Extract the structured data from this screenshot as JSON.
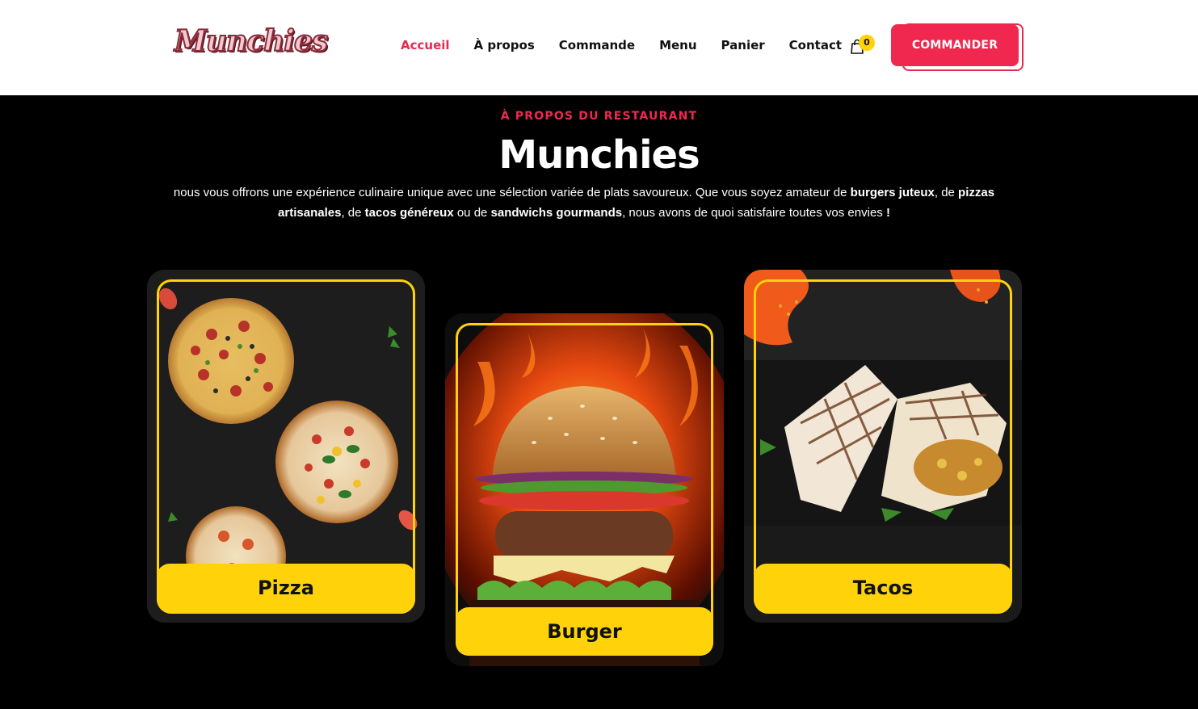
{
  "header": {
    "logo_text": "Munchies",
    "nav": [
      {
        "label": "Accueil",
        "active": true
      },
      {
        "label": "À propos",
        "active": false
      },
      {
        "label": "Commande",
        "active": false
      },
      {
        "label": "Menu",
        "active": false
      },
      {
        "label": "Panier",
        "active": false
      },
      {
        "label": "Contact",
        "active": false
      }
    ],
    "cart_icon": "shopping-bag-icon",
    "cart_count": "0",
    "order_button": "COMMANDER"
  },
  "about": {
    "eyebrow": "À PROPOS DU RESTAURANT",
    "title": "Munchies",
    "desc": {
      "p1": "nous vous offrons une expérience culinaire unique avec une sélection variée de plats savoureux. Que vous soyez amateur de ",
      "b1": "burgers juteux",
      "p2": ", de ",
      "b2": "pizzas artisanales",
      "p3": ", de ",
      "b3": "tacos généreux",
      "p4": " ou de ",
      "b4": "sandwichs gourmands",
      "p5": ", nous avons de quoi satisfaire toutes vos envies ",
      "b5": "!"
    }
  },
  "cards": [
    {
      "label": "Pizza"
    },
    {
      "label": "Burger"
    },
    {
      "label": "Tacos"
    }
  ],
  "colors": {
    "accent": "#f0284f",
    "yellow": "#ffd20a",
    "background": "#000000"
  }
}
